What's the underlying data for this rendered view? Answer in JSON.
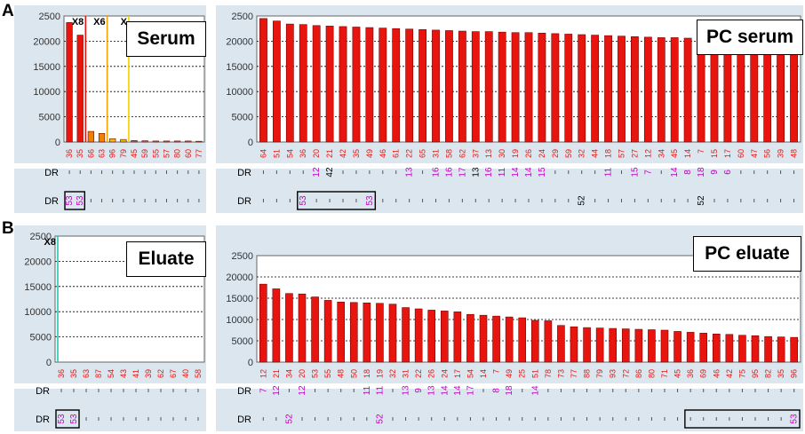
{
  "panel_labels": {
    "a": "A",
    "b": "B"
  },
  "colors": {
    "bar": "#e8150f",
    "bar_edge": "#7a0000",
    "x_label": "#e8150f",
    "dr_purple": "#c000c0",
    "panel_bg": "#dbe6ef",
    "line_red": "#e8150f",
    "line_orange": "#f5a200",
    "line_yellow": "#f0d000",
    "line_teal": "#22c8b4"
  },
  "dr_label": "DR",
  "chart_data": [
    {
      "id": "serum",
      "type": "bar",
      "legend": "Serum",
      "ylim": [
        0,
        25000
      ],
      "y_ticks": [
        "0",
        "5000",
        "10000",
        "15000",
        "20000",
        "2500"
      ],
      "categories": [
        "36",
        "35",
        "66",
        "63",
        "96",
        "79",
        "45",
        "59",
        "55",
        "57",
        "80",
        "60",
        "77"
      ],
      "values": [
        23700,
        21200,
        2100,
        1700,
        650,
        500,
        300,
        250,
        200,
        200,
        200,
        200,
        150
      ],
      "bar_colors": [
        "#e8150f",
        "#e8150f",
        "#f08000",
        "#f08000",
        "#f0c000",
        "#f0c000",
        "#2aa8a8",
        "#2aa8a8",
        "#2aa8a8",
        "#2aa8a8",
        "#2aa8a8",
        "#2aa8a8",
        "#2aa8a8"
      ],
      "markers": [
        {
          "label": "X8",
          "after_index": 1,
          "color": "#e8150f"
        },
        {
          "label": "X6",
          "after_index": 3,
          "color": "#f5a200"
        },
        {
          "label": "X",
          "after_index": 5,
          "color": "#f0d000"
        }
      ],
      "dr1": [
        "",
        "",
        "",
        "",
        "",
        "",
        "",
        "",
        "",
        "",
        "",
        "",
        ""
      ],
      "dr2": [
        "53",
        "53",
        "",
        "",
        "",
        "",
        "",
        "",
        "",
        "",
        "",
        "",
        ""
      ],
      "dr2_boxes": [
        [
          0,
          1
        ]
      ]
    },
    {
      "id": "pc_serum",
      "type": "bar",
      "legend": "PC serum",
      "ylim": [
        0,
        25000
      ],
      "y_ticks": [
        "0",
        "5000",
        "10000",
        "15000",
        "20000",
        "2500"
      ],
      "categories": [
        "64",
        "51",
        "54",
        "36",
        "20",
        "21",
        "42",
        "35",
        "49",
        "46",
        "61",
        "22",
        "65",
        "31",
        "58",
        "62",
        "37",
        "13",
        "30",
        "19",
        "26",
        "24",
        "29",
        "59",
        "32",
        "44",
        "18",
        "57",
        "27",
        "12",
        "34",
        "45",
        "14",
        "7",
        "15",
        "17",
        "60",
        "47",
        "56",
        "39",
        "48"
      ],
      "values": [
        24500,
        24000,
        23400,
        23300,
        23100,
        23000,
        22900,
        22800,
        22700,
        22600,
        22500,
        22400,
        22300,
        22200,
        22100,
        22000,
        21900,
        21900,
        21800,
        21700,
        21700,
        21600,
        21500,
        21400,
        21300,
        21200,
        21100,
        21000,
        20900,
        20800,
        20700,
        20700,
        20600,
        20500,
        20500,
        20400,
        20400,
        20300,
        20300,
        20200,
        20200
      ],
      "dr1": [
        "",
        "",
        "",
        "",
        "12",
        "12",
        "",
        "",
        "",
        "",
        "",
        "13",
        "",
        "16",
        "16",
        "17",
        "",
        "16",
        "11",
        "14",
        "14",
        "15",
        "",
        "",
        "",
        "",
        "11",
        "",
        "15",
        "7",
        "",
        "14",
        "8",
        "18",
        "9",
        "6",
        "",
        "",
        "",
        "",
        ""
      ],
      "dr2": [
        "",
        "",
        "",
        "53",
        "",
        "",
        "",
        "",
        "53",
        "",
        "",
        "",
        "",
        "",
        "",
        "",
        "",
        "",
        "",
        "",
        "",
        "",
        "",
        "",
        "",
        "",
        "",
        "",
        "",
        "",
        "",
        "",
        "",
        "",
        "",
        "",
        "",
        "",
        "",
        "",
        ""
      ],
      "dr2_black": {
        "24": "52",
        "33": "52"
      },
      "dr1_small": {
        "5": "42",
        "16": "13"
      },
      "dr2_boxes": [
        [
          3,
          8
        ]
      ]
    },
    {
      "id": "eluate",
      "type": "bar",
      "legend": "Eluate",
      "ylim": [
        0,
        25000
      ],
      "y_ticks": [
        "0",
        "5000",
        "10000",
        "15000",
        "20000",
        "2500"
      ],
      "categories": [
        "36",
        "35",
        "63",
        "87",
        "54",
        "43",
        "41",
        "39",
        "62",
        "67",
        "40",
        "58"
      ],
      "values": [
        0,
        0,
        0,
        0,
        0,
        0,
        0,
        0,
        0,
        0,
        0,
        0
      ],
      "markers": [
        {
          "label": "X8",
          "after_index": -1,
          "color": "#22c8b4"
        }
      ],
      "dr1": [
        "",
        "",
        "",
        "",
        "",
        "",
        "",
        "",
        "",
        "",
        "",
        ""
      ],
      "dr2": [
        "53",
        "53",
        "",
        "",
        "",
        "",
        "",
        "",
        "",
        "",
        "",
        ""
      ],
      "dr2_boxes": [
        [
          0,
          1
        ]
      ]
    },
    {
      "id": "pc_eluate",
      "type": "bar",
      "legend": "PC eluate",
      "ylim": [
        0,
        25000
      ],
      "y_ticks": [
        "0",
        "5000",
        "10000",
        "15000",
        "20000",
        "2500"
      ],
      "categories": [
        "12",
        "21",
        "34",
        "20",
        "53",
        "55",
        "48",
        "50",
        "18",
        "19",
        "32",
        "31",
        "22",
        "26",
        "24",
        "17",
        "54",
        "14",
        "7",
        "49",
        "25",
        "51",
        "78",
        "73",
        "77",
        "88",
        "79",
        "93",
        "72",
        "86",
        "80",
        "71",
        "45",
        "36",
        "69",
        "46",
        "42",
        "75",
        "95",
        "82",
        "35",
        "96"
      ],
      "values": [
        18300,
        17200,
        16100,
        16000,
        15300,
        14500,
        14100,
        14000,
        13900,
        13800,
        13600,
        12800,
        12500,
        12200,
        12000,
        11800,
        11200,
        11000,
        10800,
        10600,
        10400,
        9800,
        9700,
        8600,
        8300,
        8100,
        8000,
        7900,
        7800,
        7700,
        7600,
        7500,
        7200,
        7000,
        6800,
        6600,
        6500,
        6300,
        6200,
        6000,
        5900,
        5800
      ],
      "dr1": [
        "7",
        "12",
        "",
        "12",
        "",
        "",
        "",
        "",
        "11",
        "11",
        "",
        "13",
        "9",
        "13",
        "14",
        "14",
        "17",
        "",
        "8",
        "18",
        "",
        "14",
        "",
        "",
        "",
        "",
        "",
        "",
        "",
        "",
        "",
        "",
        "",
        "",
        "",
        "",
        "",
        "",
        "",
        "",
        "",
        ""
      ],
      "dr2": [
        "",
        "",
        "52",
        "",
        "",
        "",
        "",
        "",
        "",
        "52",
        "",
        "",
        "",
        "",
        "",
        "",
        "",
        "",
        "",
        "",
        "",
        "",
        "",
        "",
        "",
        "",
        "",
        "",
        "",
        "",
        "",
        "",
        "",
        "",
        "",
        "",
        "",
        "",
        "",
        "",
        "",
        "53"
      ],
      "dr2_boxes": [
        [
          33,
          41
        ]
      ]
    }
  ]
}
